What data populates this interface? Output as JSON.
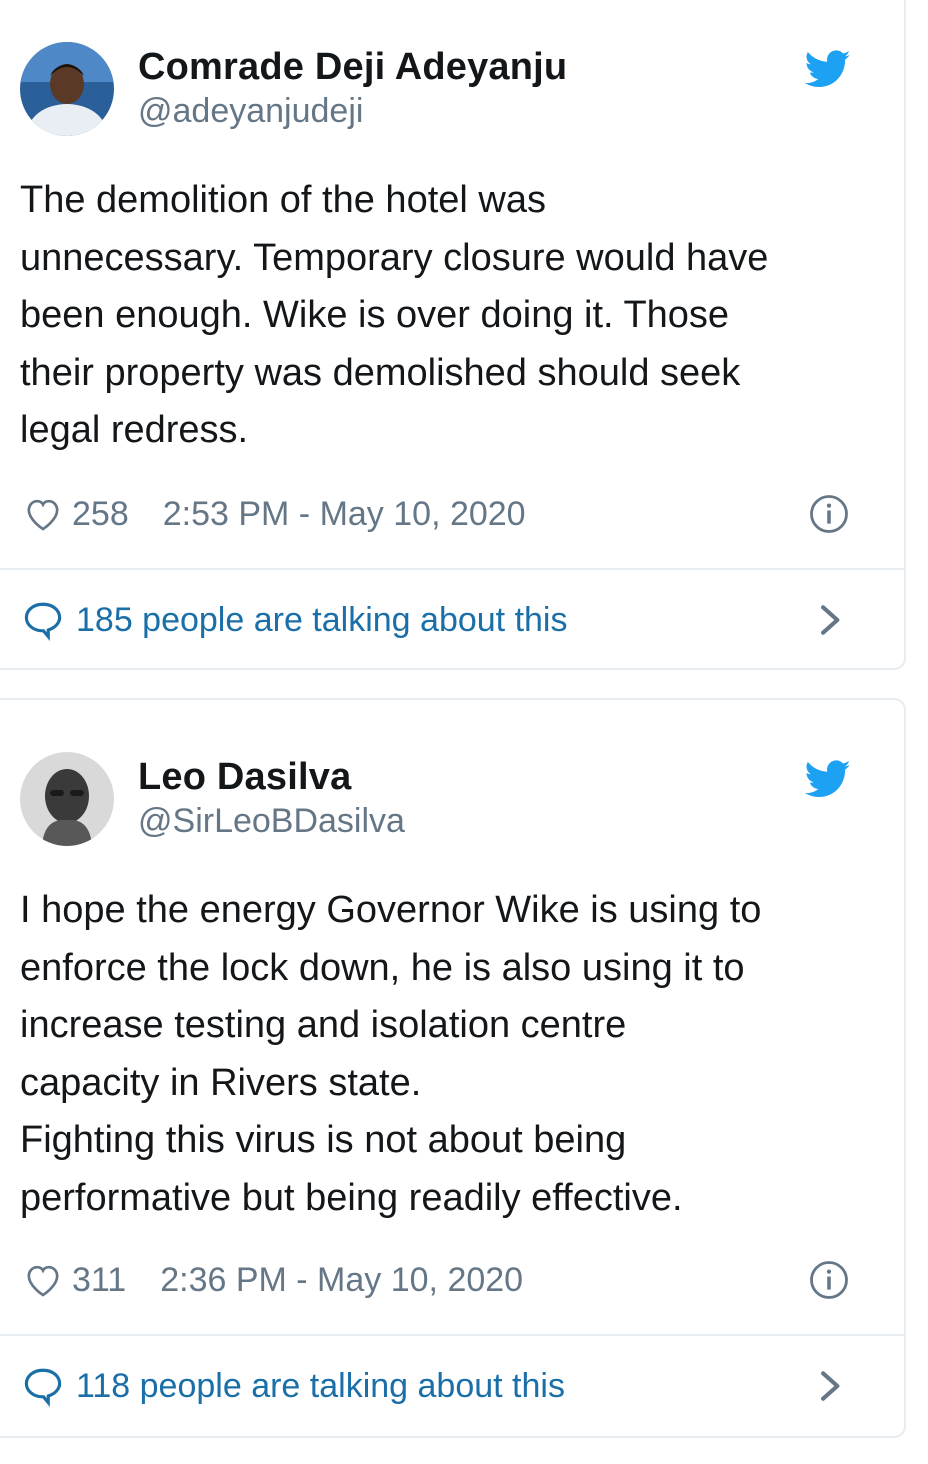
{
  "tweets": [
    {
      "author_name": "Comrade Deji Adeyanju",
      "author_handle": "@adeyanjudeji",
      "text": "The demolition of the hotel was\nunnecessary. Temporary closure would have\nbeen enough. Wike is over doing it. Those\ntheir property was demolished should seek\nlegal redress.",
      "likes": "258",
      "timestamp": "2:53 PM - May 10, 2020",
      "talking": "185 people are talking about this"
    },
    {
      "author_name": "Leo Dasilva",
      "author_handle": "@SirLeoBDasilva",
      "text": "I hope the energy Governor Wike is using to\nenforce the lock down, he is also using it to\nincrease testing and isolation centre\ncapacity in Rivers state.\nFighting this virus is not about being\nperformative but being readily effective.",
      "likes": "311",
      "timestamp": "2:36 PM - May 10, 2020",
      "talking": "118 people are talking about this"
    }
  ],
  "icons": {
    "brand": "twitter-bird-icon",
    "like": "heart-outline-icon",
    "info": "info-circle-icon",
    "reply": "speech-bubble-icon",
    "more": "chevron-right-icon"
  },
  "colors": {
    "twitter_blue": "#1da1f2",
    "link_blue": "#1b6fa8",
    "muted_gray": "#657786",
    "text_dark": "#14171a",
    "border": "#e6ecf0"
  }
}
